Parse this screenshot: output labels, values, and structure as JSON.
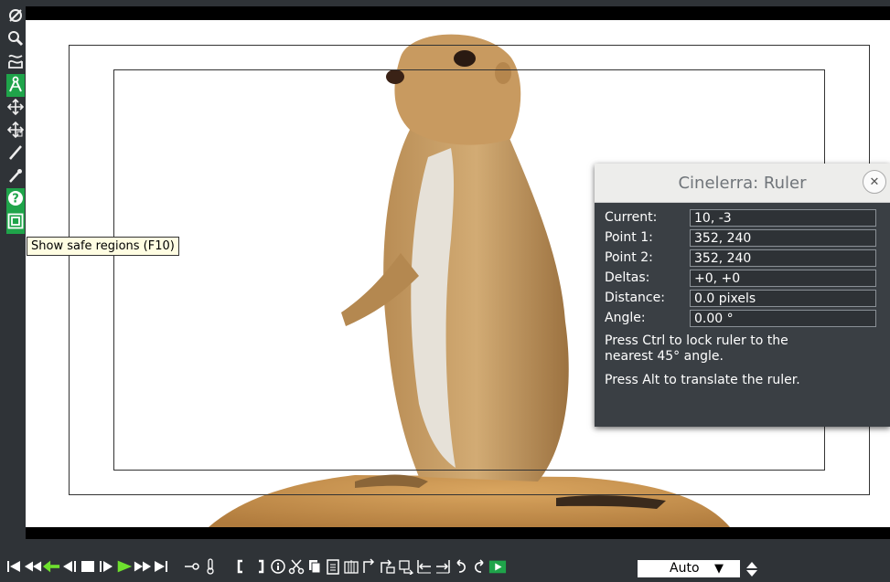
{
  "toolbar_left": [
    {
      "icon": "protect-icon",
      "active": false
    },
    {
      "icon": "magnify-icon",
      "active": false
    },
    {
      "icon": "mask-icon",
      "active": false
    },
    {
      "icon": "ruler-icon",
      "active": true
    },
    {
      "icon": "camera-icon",
      "active": false
    },
    {
      "icon": "projector-icon",
      "active": false
    },
    {
      "icon": "crop-icon",
      "active": false
    },
    {
      "icon": "eyedropper-icon",
      "active": false
    },
    {
      "icon": "help-icon",
      "active": true
    },
    {
      "icon": "safe-regions-icon",
      "active": true
    }
  ],
  "tooltip": "Show safe regions (F10)",
  "ruler_dialog": {
    "title": "Cinelerra: Ruler",
    "rows": [
      {
        "label": "Current:",
        "value": "10, -3"
      },
      {
        "label": "Point 1:",
        "value": "352, 240"
      },
      {
        "label": "Point 2:",
        "value": "352, 240"
      },
      {
        "label": "Deltas:",
        "value": "+0, +0"
      },
      {
        "label": "Distance:",
        "value": "0.0 pixels"
      },
      {
        "label": "Angle:",
        "value": "0.00 °"
      }
    ],
    "hint1": "Press Ctrl to lock ruler to the nearest 45° angle.",
    "hint2": "Press Alt to translate the ruler."
  },
  "zoom": {
    "value": "Auto"
  },
  "colors": {
    "accent": "#1fa44a",
    "play_green": "#6ee02e"
  }
}
